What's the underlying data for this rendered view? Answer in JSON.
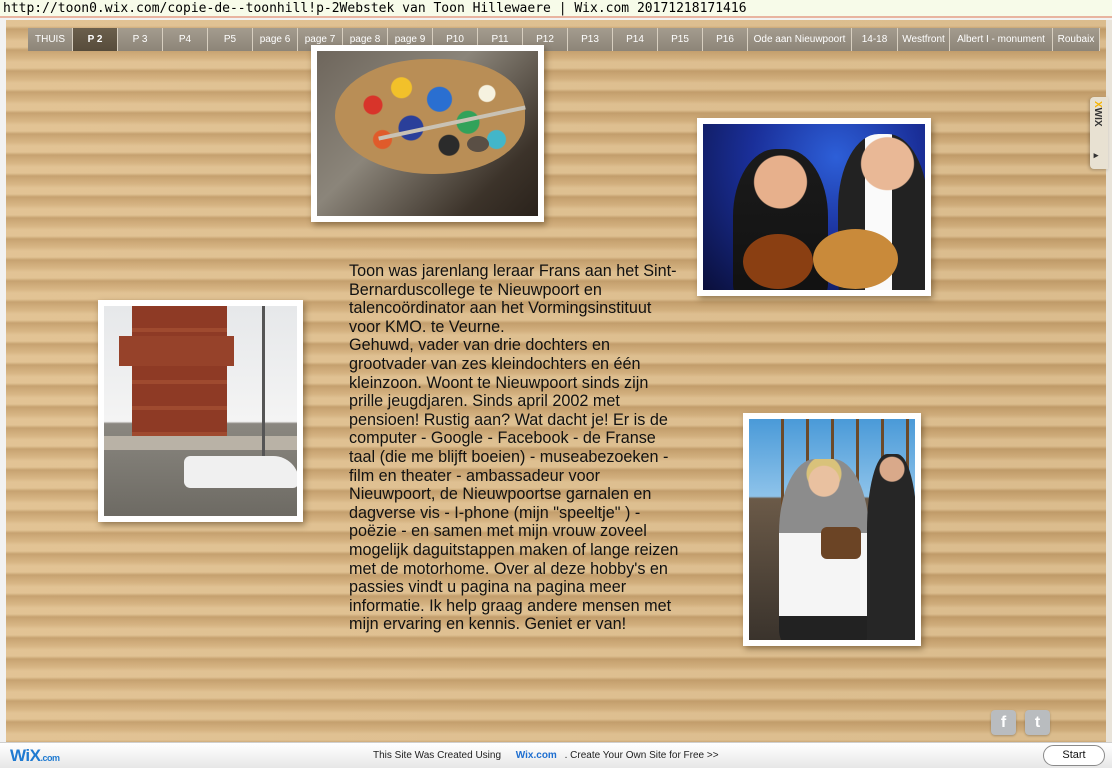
{
  "archive": {
    "url_text": "http://toon0.wix.com/copie-de--toonhill!p-2Webstek van Toon Hillewaere | Wix.com 20171218171416"
  },
  "nav": {
    "items": [
      {
        "label": "THUIS"
      },
      {
        "label": "P 2",
        "active": true
      },
      {
        "label": "P 3"
      },
      {
        "label": "P4"
      },
      {
        "label": "P5"
      },
      {
        "label": "page 6"
      },
      {
        "label": "page 7"
      },
      {
        "label": "page 8"
      },
      {
        "label": "page 9"
      },
      {
        "label": "P10"
      },
      {
        "label": "P11"
      },
      {
        "label": "P12"
      },
      {
        "label": "P13"
      },
      {
        "label": "P14"
      },
      {
        "label": "P15"
      },
      {
        "label": "P16"
      },
      {
        "label": "Ode aan Nieuwpoort"
      },
      {
        "label": "14-18"
      },
      {
        "label": "Westfront"
      },
      {
        "label": "Albert  I - monument"
      },
      {
        "label": "Roubaix"
      }
    ]
  },
  "bio": {
    "paragraph1": "Toon was jarenlang leraar  Frans aan het Sint-Bernarduscollege te Nieuwpoort en talencoördinator aan het Vormingsinstituut voor KMO. te Veurne.",
    "paragraph2": "Gehuwd, vader van drie dochters en grootvader van zes kleindochters en één kleinzoon. Woont te Nieuwpoort sinds zijn prille jeugdjaren. Sinds april 2002 met pensioen! Rustig aan? Wat dacht je! Er is de computer - Google - Facebook - de Franse taal (die me blijft boeien) - museabezoeken - film en theater - ambassadeur voor Nieuwpoort, de Nieuwpoortse garnalen en dagverse vis - I-phone (mijn \"speeltje\" ) - poëzie - en samen met mijn vrouw zoveel mogelijk daguitstappen maken of lange reizen met de motorhome. Over al deze hobby's en passies vindt u pagina na pagina meer informatie. Ik help graag andere mensen met mijn ervaring en kennis. Geniet er van!"
  },
  "social": {
    "facebook_glyph": "f",
    "twitter_glyph": "t",
    "icons": [
      "facebook-icon",
      "twitter-icon"
    ]
  },
  "wix_tab": {
    "logo_x": "X",
    "logo_rest": "WIX",
    "arrow": "▸"
  },
  "footer": {
    "logo_main": "WiX",
    "logo_suffix": ".com",
    "promo_text": "This Site Was Created Using",
    "promo_link": "Wix.com",
    "promo_tail": ". Create Your Own Site for Free >>",
    "start_label": "Start"
  },
  "colors": {
    "board": "#d3ae7a",
    "nav_bg": "#9a9284",
    "nav_active": "#5f5443",
    "wix_blue": "#1f7ad1"
  }
}
